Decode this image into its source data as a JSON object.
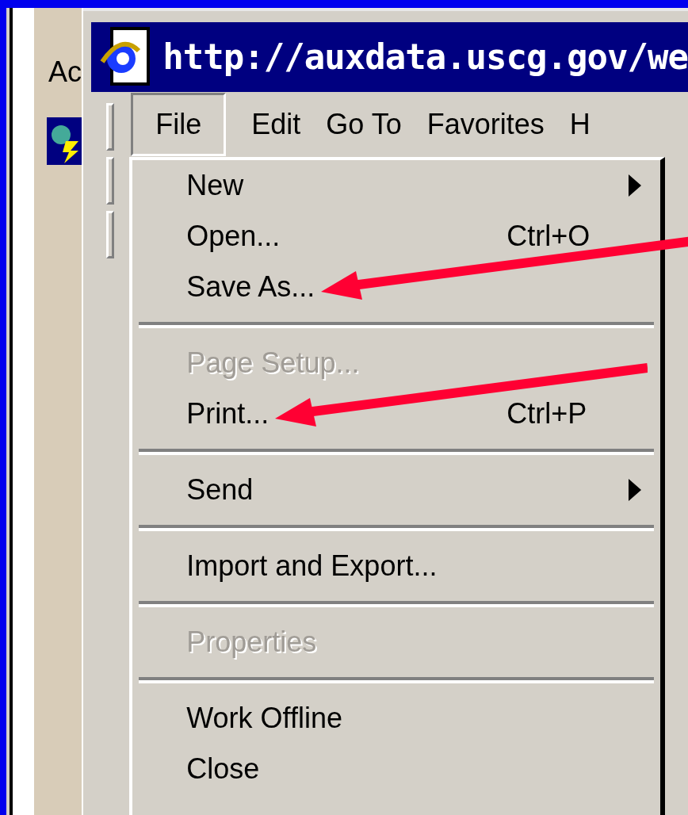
{
  "background_window": {
    "title": "Ac"
  },
  "window": {
    "title": "http://auxdata.uscg.gov/we"
  },
  "menubar": [
    {
      "label": "File",
      "selected": true
    },
    {
      "label": "Edit",
      "selected": false
    },
    {
      "label": "Go To",
      "selected": false
    },
    {
      "label": "Favorites",
      "selected": false
    },
    {
      "label": "H",
      "selected": false
    }
  ],
  "menu": {
    "items": [
      {
        "kind": "item",
        "label": "New",
        "submenu": true,
        "disabled": false
      },
      {
        "kind": "item",
        "label": "Open...",
        "shortcut": "Ctrl+O",
        "submenu": false,
        "disabled": false
      },
      {
        "kind": "item",
        "label": "Save As...",
        "submenu": false,
        "disabled": false,
        "callout": true
      },
      {
        "kind": "separator"
      },
      {
        "kind": "item",
        "label": "Page Setup...",
        "submenu": false,
        "disabled": true
      },
      {
        "kind": "item",
        "label": "Print...",
        "shortcut": "Ctrl+P",
        "submenu": false,
        "disabled": false,
        "callout": true
      },
      {
        "kind": "separator"
      },
      {
        "kind": "item",
        "label": "Send",
        "submenu": true,
        "disabled": false
      },
      {
        "kind": "separator"
      },
      {
        "kind": "item",
        "label": "Import and Export...",
        "submenu": false,
        "disabled": false
      },
      {
        "kind": "separator"
      },
      {
        "kind": "item",
        "label": "Properties",
        "submenu": false,
        "disabled": true
      },
      {
        "kind": "separator"
      },
      {
        "kind": "item",
        "label": "Work Offline",
        "submenu": false,
        "disabled": false
      },
      {
        "kind": "item",
        "label": "Close",
        "submenu": false,
        "disabled": false
      }
    ]
  }
}
